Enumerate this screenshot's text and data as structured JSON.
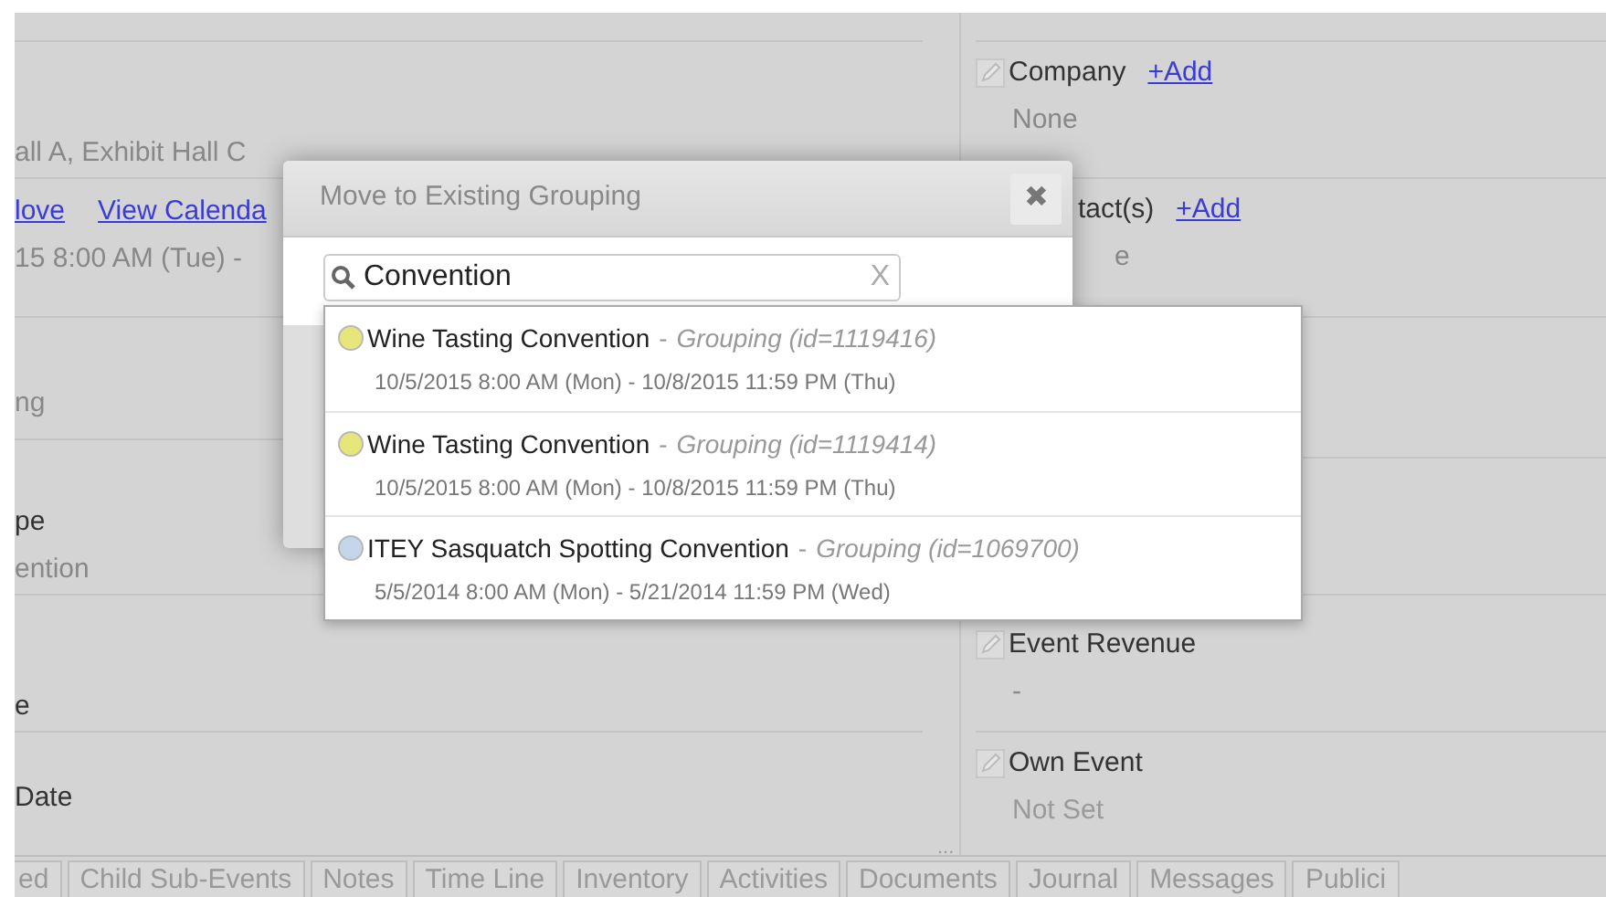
{
  "left_fields": [
    {
      "lines": [
        {
          "text": "all A, Exhibit Hall C",
          "kind": "value"
        }
      ]
    },
    {
      "links": [
        "love",
        "View Calenda"
      ],
      "lines": [
        {
          "text": "15 8:00 AM (Tue) -",
          "kind": "value"
        }
      ]
    },
    {
      "lines": [
        {
          "text": "ng",
          "kind": "value"
        }
      ]
    },
    {
      "lines": [
        {
          "text": "pe",
          "kind": "label"
        },
        {
          "text": "ention",
          "kind": "value"
        }
      ]
    },
    {
      "lines": [
        {
          "text": "e",
          "kind": "label"
        }
      ]
    },
    {
      "lines": [
        {
          "text": "Date",
          "kind": "label"
        }
      ]
    }
  ],
  "right_fields": [
    {
      "label": "Company",
      "add_link": "+Add",
      "value": "None"
    },
    {
      "label": "tact(s)",
      "add_link": "+Add",
      "value": "e"
    },
    {
      "label": "Event Revenue",
      "value": "-"
    },
    {
      "label": "Own Event",
      "value": "Not Set"
    }
  ],
  "dialog": {
    "title": "Move to Existing Grouping",
    "close": "✖",
    "search": {
      "value": "Convention",
      "clear": "X"
    },
    "results": [
      {
        "name": "Wine Tasting Convention",
        "separator": "-",
        "type": "Grouping (id=1119416)",
        "dates": "10/5/2015 8:00 AM (Mon) - 10/8/2015 11:59 PM (Thu)",
        "color": "#e6e67a"
      },
      {
        "name": "Wine Tasting Convention",
        "separator": "-",
        "type": "Grouping (id=1119414)",
        "dates": "10/5/2015 8:00 AM (Mon) - 10/8/2015 11:59 PM (Thu)",
        "color": "#e6e67a"
      },
      {
        "name": "ITEY Sasquatch Spotting Convention",
        "separator": "-",
        "type": "Grouping (id=1069700)",
        "dates": "5/5/2014 8:00 AM (Mon) - 5/21/2014 11:59 PM (Wed)",
        "color": "#c6d6ea"
      }
    ]
  },
  "splitter": "...",
  "tabs": [
    {
      "label": "ed",
      "selected": false
    },
    {
      "label": "Child Sub-Events",
      "selected": false
    },
    {
      "label": "Notes",
      "selected": false
    },
    {
      "label": "Time Line",
      "selected": false
    },
    {
      "label": "Inventory",
      "selected": false
    },
    {
      "label": "Activities",
      "selected": false
    },
    {
      "label": "Documents",
      "selected": false
    },
    {
      "label": "Journal",
      "selected": false
    },
    {
      "label": "Messages",
      "selected": false
    },
    {
      "label": "Publici",
      "selected": false
    }
  ]
}
